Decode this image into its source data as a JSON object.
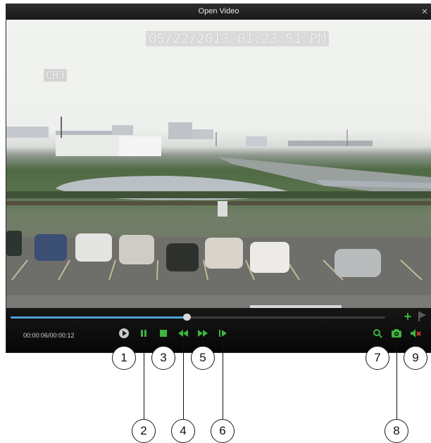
{
  "window": {
    "title": "Open Video",
    "close_icon": "×"
  },
  "video": {
    "osd_timestamp": "05/22/2013 01:23:51 PM",
    "osd_channel": "CH3"
  },
  "controls": {
    "time_label": "00:00:06/00:00:12",
    "progress": 0.47,
    "accent_color": "#3db53d",
    "seek_color": "#4da3d8",
    "add_icon": "+",
    "buttons": [
      {
        "name": "play-icon"
      },
      {
        "name": "pause-icon"
      },
      {
        "name": "stop-icon"
      },
      {
        "name": "rewind-icon"
      },
      {
        "name": "fast-forward-icon"
      },
      {
        "name": "step-forward-icon"
      },
      {
        "name": "zoom-icon"
      },
      {
        "name": "snapshot-camera-icon"
      },
      {
        "name": "mute-icon"
      }
    ]
  },
  "callouts": [
    "1",
    "2",
    "3",
    "4",
    "5",
    "6",
    "7",
    "8",
    "9"
  ]
}
